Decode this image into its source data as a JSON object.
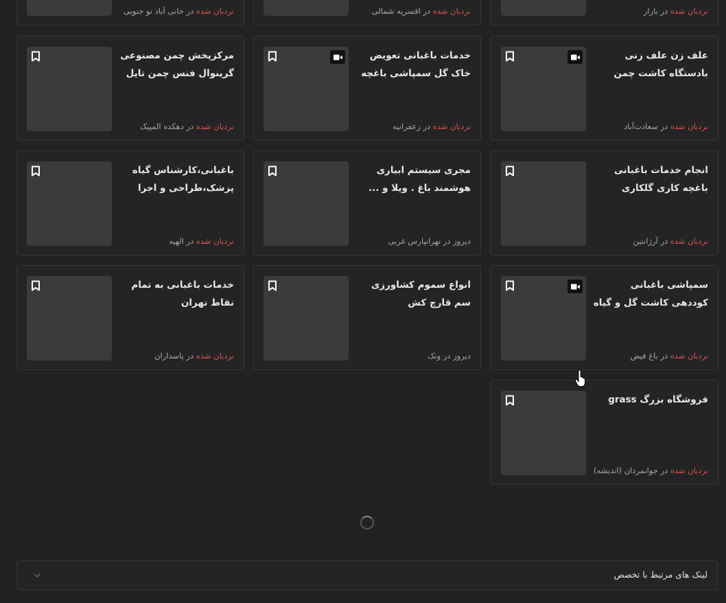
{
  "ladder_label": "نردبان شده",
  "colors": {
    "background": "#222222",
    "card": "#242424",
    "ladder_red": "#d95454",
    "thumb": "#3b3b3b"
  },
  "top_partial_row": [
    {
      "meta_red": "نردبان شده",
      "meta_rest": " در بازار"
    },
    {
      "meta_red": "نردبان شده",
      "meta_rest": " در افسریه شمالی"
    },
    {
      "meta_red": "نردبان شده",
      "meta_rest": " در خانی آباد نو جنوبی"
    }
  ],
  "cards": [
    {
      "title": "علف زن علف زنی بادستگاه کاشت چمن طبیعی",
      "meta_red": "نردبان شده",
      "meta_rest": " در سعادت‌آباد",
      "has_video": true
    },
    {
      "title": "خدمات باغبانی تعویض خاک گل سمپاشی باغچه کاری شخم",
      "meta_red": "نردبان شده",
      "meta_rest": " در زعفرانیه",
      "has_video": true
    },
    {
      "title": "مرکزپخش چمن مصنوعی گرینوال فنس چمن تایل ترمو",
      "meta_red": "نردبان شده",
      "meta_rest": " در دهکده المپیک",
      "has_video": false
    },
    {
      "title": "انجام خدمات باغبانی باغچه کاری گلکاری",
      "meta_red": "نردبان شده",
      "meta_rest": " در آرژانتین",
      "has_video": false
    },
    {
      "title": "مجری سیستم ابیاری هوشمند باغ . ویلا و ...",
      "meta_red": "",
      "meta_rest": "دیروز در تهرانپارس غربی",
      "has_video": false
    },
    {
      "title": "باغبانی،کارشناس گیاه پزشک،طراحی و اجرا روفگاردن",
      "meta_red": "نردبان شده",
      "meta_rest": " در الهیه",
      "has_video": false
    },
    {
      "title": "سمپاشی باغبانی کوددهی کاشت گل و گیاه خدمات",
      "meta_red": "نردبان شده",
      "meta_rest": " در باغ فیض",
      "has_video": true
    },
    {
      "title": "انواع سموم کشاورزی سم قارچ کش",
      "meta_red": "",
      "meta_rest": "دیروز در ونک",
      "has_video": false
    },
    {
      "title": "خدمات باغبانی به تمام نقاط تهران",
      "meta_red": "نردبان شده",
      "meta_rest": " در پاسداران",
      "has_video": false
    },
    {
      "title": "فروشگاه بزرگ grass",
      "meta_red": "نردبان شده",
      "meta_rest": " در جوانمردان (اندیشه)",
      "has_video": false
    }
  ],
  "related_links": {
    "label": "لینک های مرتبط با تخصص"
  }
}
